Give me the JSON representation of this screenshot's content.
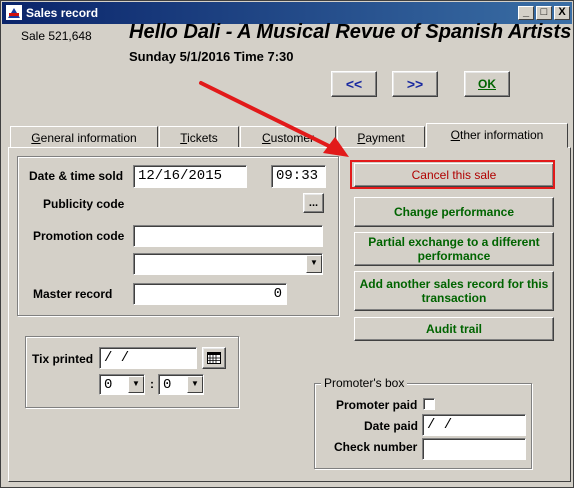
{
  "window": {
    "title": "Sales record",
    "controls": [
      "_",
      "□",
      "X"
    ]
  },
  "header": {
    "sale_number": "Sale 521,648",
    "show_title": "Hello Dali - A Musical Revue of Spanish Artists",
    "show_datetime": "Sunday 5/1/2016  Time 7:30"
  },
  "nav": {
    "prev_label": "<<",
    "next_label": ">>",
    "ok_label": "OK"
  },
  "tabs": [
    {
      "label": "General information"
    },
    {
      "label": "Tickets"
    },
    {
      "label": "Customer"
    },
    {
      "label": "Payment"
    },
    {
      "label": "Other information",
      "active": true
    }
  ],
  "form": {
    "date_time_sold_label": "Date & time sold",
    "date_sold": "12/16/2015",
    "time_sold": "09:33",
    "publicity_code_label": "Publicity code",
    "publicity_lookup_label": "...",
    "promotion_code_label": "Promotion code",
    "promotion_code_value": "",
    "promotion_dropdown_value": "",
    "master_record_label": "Master record",
    "master_record_value": "0"
  },
  "tix": {
    "label": "Tix printed",
    "date_value": " /  /",
    "hour_value": "0",
    "minute_value": "0",
    "separator": ":"
  },
  "actions": {
    "cancel_sale": "Cancel this sale",
    "change_performance": "Change performance",
    "partial_exchange": "Partial exchange to a different performance",
    "add_sales_record": "Add another sales record for this transaction",
    "audit_trail": "Audit trail"
  },
  "promoter": {
    "box_title": "Promoter's box",
    "paid_label": "Promoter paid",
    "paid_checked": false,
    "date_paid_label": "Date paid",
    "date_paid_value": " /  /",
    "check_number_label": "Check number",
    "check_number_value": ""
  },
  "colors": {
    "titlebar": "#0a246a",
    "action_text": "#006400",
    "cancel_text": "#b00000",
    "annotation_red": "#e21a1a",
    "nav_text": "#1a2aa0"
  }
}
